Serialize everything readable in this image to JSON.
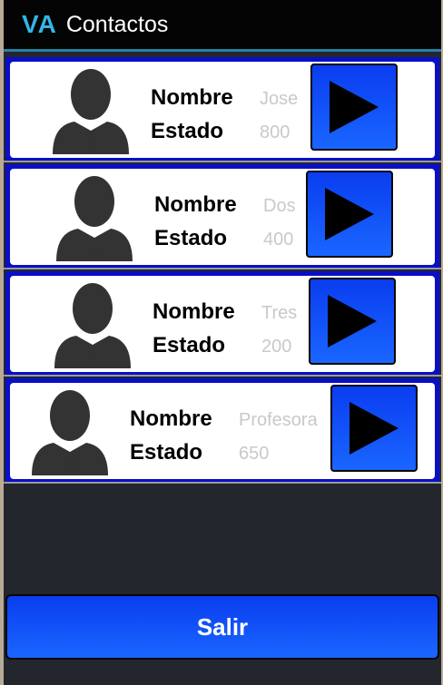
{
  "actionbar": {
    "logo": "VA",
    "title": "Contactos"
  },
  "contacts": [
    {
      "nombre_label": "Nombre",
      "estado_label": "Estado",
      "nombre": "Jose",
      "estado": "800"
    },
    {
      "nombre_label": "Nombre",
      "estado_label": "Estado",
      "nombre": "Dos",
      "estado": "400"
    },
    {
      "nombre_label": "Nombre",
      "estado_label": "Estado",
      "nombre": "Tres",
      "estado": "200"
    },
    {
      "nombre_label": "Nombre",
      "estado_label": "Estado",
      "nombre": "Profesora",
      "estado": "650"
    }
  ],
  "exit": {
    "label": "Salir"
  },
  "colors": {
    "accent": "#33b5e5",
    "button": "#1a4fff",
    "row_border": "#0a0ec8"
  }
}
